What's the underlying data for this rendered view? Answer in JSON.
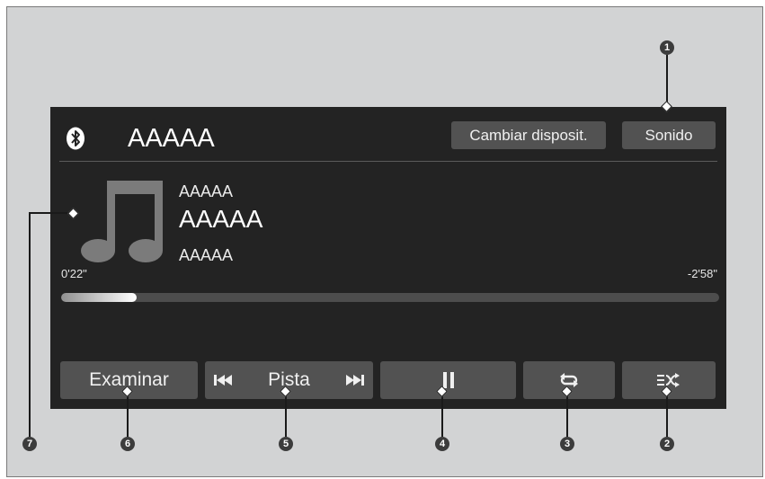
{
  "header": {
    "title": "AAAAA",
    "change_device_label": "Cambiar disposit.",
    "sound_label": "Sonido"
  },
  "now_playing": {
    "line1": "AAAAA",
    "line2": "AAAAA",
    "line3": "AAAAA",
    "elapsed": "0'22\"",
    "remaining": "-2'58\"",
    "progress": 0.115
  },
  "controls": {
    "browse_label": "Examinar",
    "track_label": "Pista"
  },
  "icons": {
    "bluetooth": "bluetooth-icon",
    "album_art": "music-note-icon",
    "prev": "skip-previous-icon",
    "next": "skip-next-icon",
    "pause": "pause-icon",
    "repeat": "repeat-icon",
    "shuffle": "shuffle-icon"
  },
  "callouts": [
    "1",
    "2",
    "3",
    "4",
    "5",
    "6",
    "7"
  ],
  "colors": {
    "screen_bg": "#232323",
    "button_bg": "#525252",
    "page_bg": "#d2d3d4"
  }
}
